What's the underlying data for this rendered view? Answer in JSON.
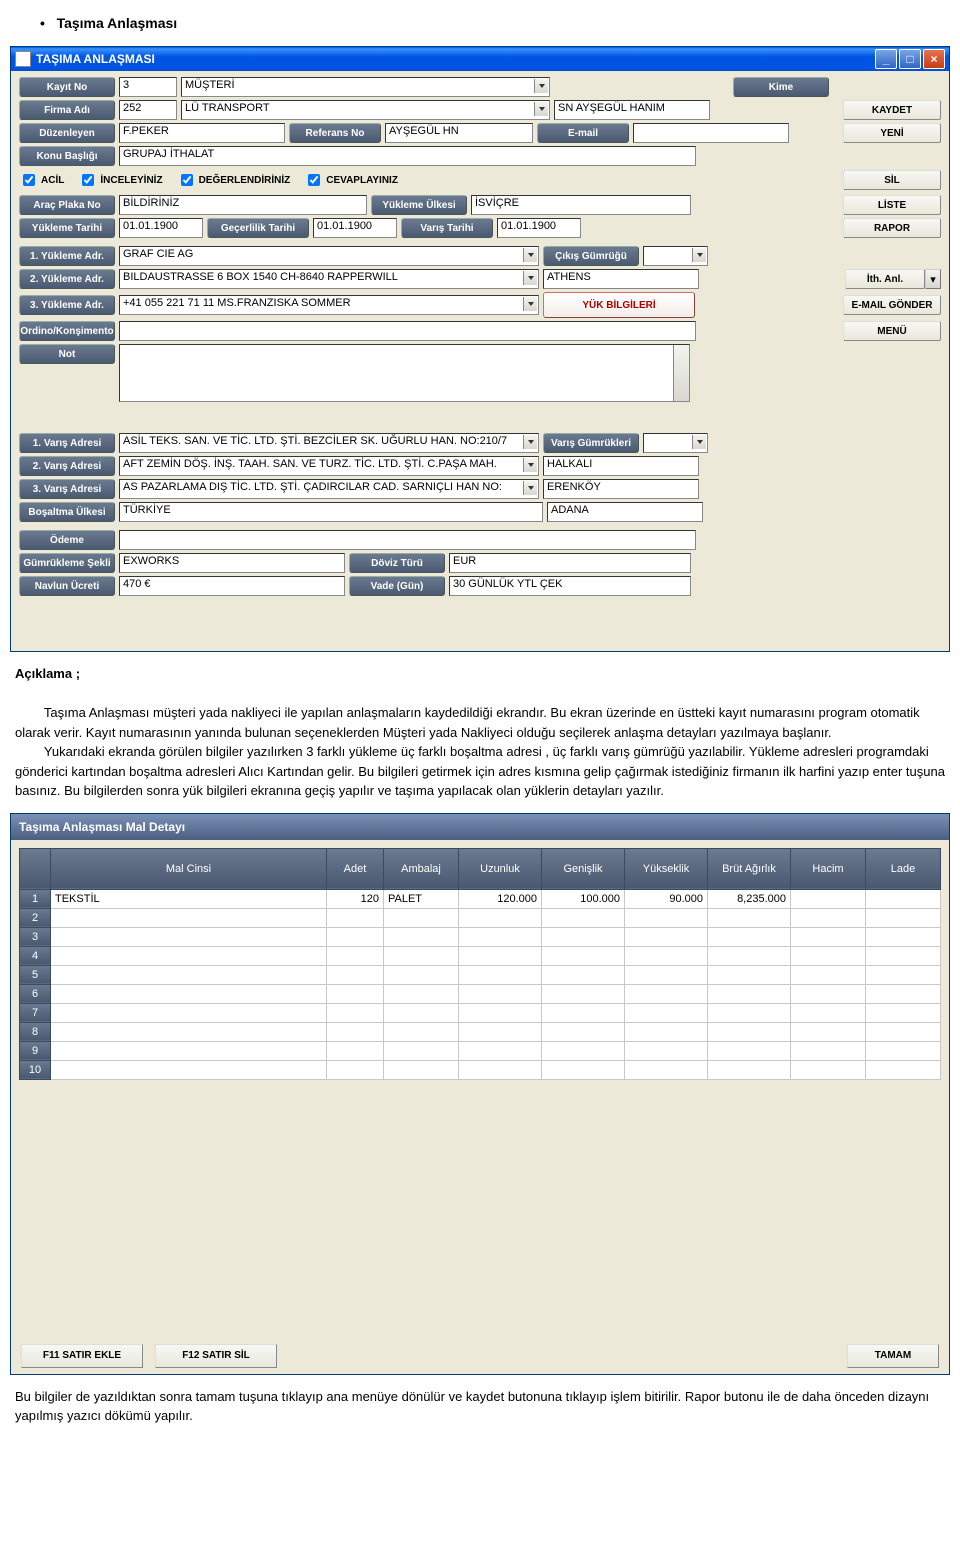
{
  "doc": {
    "heading": "Taşıma Anlaşması",
    "aciklama": "Açıklama ;",
    "p1_a": "Taşıma Anlaşması müşteri yada nakliyeci ile yapılan anlaşmaların kaydedildiği ekrandır. Bu ekran üzerinde en üstteki kayıt numarasını program otomatik olarak verir. Kayıt numarasının yanında bulunan seçeneklerden Müşteri yada Nakliyeci olduğu seçilerek anlaşma detayları yazılmaya başlanır.",
    "p1_b": "Yukarıdaki ekranda görülen bilgiler yazılırken 3 farklı yükleme üç farklı boşaltma adresi , üç farklı varış gümrüğü yazılabilir. Yükleme adresleri programdaki gönderici kartından boşaltma adresleri Alıcı Kartından gelir. Bu bilgileri getirmek için adres kısmına gelip çağırmak istediğiniz firmanın ilk harfini yazıp enter tuşuna basınız. Bu bilgilerden sonra yük bilgileri ekranına geçiş yapılır ve taşıma yapılacak olan yüklerin detayları yazılır.",
    "p2": "Bu bilgiler de yazıldıktan sonra tamam tuşuna tıklayıp ana menüye dönülür ve kaydet butonuna tıklayıp işlem bitirilir. Rapor butonu ile de daha önceden dizaynı yapılmış yazıcı dökümü yapılır."
  },
  "win": {
    "title": "TAŞIMA ANLAŞMASI",
    "labels": {
      "kayitno": "Kayıt No",
      "kime": "Kime",
      "firmaadi": "Firma Adı",
      "duzenleyen": "Düzenleyen",
      "referansno": "Referans No",
      "email": "E-mail",
      "konubasligi": "Konu Başlığı",
      "aracplaka": "Araç Plaka No",
      "yuklemeulkesi": "Yükleme Ülkesi",
      "yuklemetarihi": "Yükleme Tarihi",
      "gecerlilik": "Geçerlilik Tarihi",
      "varistarihi": "Varış Tarihi",
      "yadr1": "1. Yükleme Adr.",
      "yadr2": "2. Yükleme Adr.",
      "yadr3": "3. Yükleme Adr.",
      "cikisgumrugu": "Çıkış Gümrüğü",
      "ordino": "Ordino/Konşimento",
      "not": "Not",
      "vadr1": "1. Varış Adresi",
      "vadr2": "2. Varış Adresi",
      "vadr3": "3. Varış Adresi",
      "varisgumrukleri": "Varış Gümrükleri",
      "bosaltmaulkesi": "Boşaltma Ülkesi",
      "odeme": "Ödeme",
      "gumruksekli": "Gümrükleme Şekli",
      "dovizturu": "Döviz Türü",
      "navlun": "Navlun Ücreti",
      "vade": "Vade (Gün)"
    },
    "values": {
      "kayitno": "3",
      "kayittip": "MÜŞTERİ",
      "kime": "",
      "firmaadi_kod": "252",
      "firmaadi": "LÜ TRANSPORT",
      "sn": "SN AYŞEGÜL HANIM",
      "duzenleyen": "F.PEKER",
      "referansno": "AYŞEGÜL HN",
      "email": "",
      "konubasligi": "GRUPAJ İTHALAT",
      "aracplaka": "BİLDİRİNİZ",
      "yuklemeulkesi": "İSVİÇRE",
      "yuklemetarihi": "01.01.1900",
      "gecerlilik": "01.01.1900",
      "varistarihi": "01.01.1900",
      "yadr1": "GRAF CIE AG",
      "cikisgumrugu": "",
      "yadr2": "BILDAUSTRASSE 6 BOX 1540  CH-8640 RAPPERWILL",
      "athens": "ATHENS",
      "yadr3": "+41 055 221 71 11 MS.FRANZISKA SOMMER",
      "vadr1": "ASİL TEKS. SAN. VE TİC. LTD. ŞTİ. BEZCİLER SK. UĞURLU HAN. NO:210/7",
      "varisgumrukleri": "",
      "vadr2": "AFT ZEMİN DÖŞ. İNŞ. TAAH. SAN. VE TURZ. TİC. LTD. ŞTİ. C.PAŞA MAH.",
      "halkali": "HALKALI",
      "vadr3": "AS PAZARLAMA DIŞ TİC. LTD. ŞTİ. ÇADIRCILAR CAD. SARNIÇLI HAN NO:",
      "erenkoy": "ERENKÖY",
      "bosaltmaulkesi": "TÜRKİYE",
      "adana": "ADANA",
      "gumruksekli": "EXWORKS",
      "dovizturu": "EUR",
      "navlun": "470 €",
      "vade": "30 GÜNLÜK YTL  ÇEK"
    },
    "checks": {
      "acil": "ACİL",
      "inceleyiniz": "İNCELEYİNİZ",
      "degerlendiriniz": "DEĞERLENDİRİNİZ",
      "cevaplayiniz": "CEVAPLAYINIZ"
    },
    "buttons": {
      "kaydet": "KAYDET",
      "yeni": "YENİ",
      "sil": "SİL",
      "liste": "LİSTE",
      "rapor": "RAPOR",
      "ithanl": "İth. Anl.",
      "emailgonder": "E-MAIL GÖNDER",
      "menu": "MENÜ",
      "yukbilgileri": "YÜK BİLGİLERİ"
    }
  },
  "detail": {
    "title": "Taşıma Anlaşması Mal Detayı",
    "cols": [
      "Mal Cinsi",
      "Adet",
      "Ambalaj",
      "Uzunluk",
      "Genişlik",
      "Yükseklik",
      "Brüt Ağırlık",
      "Hacim",
      "Lade"
    ],
    "rows": [
      {
        "n": "1",
        "cinsi": "TEKSTİL",
        "adet": "120",
        "ambalaj": "PALET",
        "uzunluk": "120.000",
        "genislik": "100.000",
        "yukseklik": "90.000",
        "brut": "8,235.000",
        "hacim": "",
        "lade": ""
      },
      {
        "n": "2"
      },
      {
        "n": "3"
      },
      {
        "n": "4"
      },
      {
        "n": "5"
      },
      {
        "n": "6"
      },
      {
        "n": "7"
      },
      {
        "n": "8"
      },
      {
        "n": "9"
      },
      {
        "n": "10"
      }
    ],
    "buttons": {
      "ekle": "F11 SATIR EKLE",
      "sil": "F12 SATIR SİL",
      "tamam": "TAMAM"
    }
  }
}
